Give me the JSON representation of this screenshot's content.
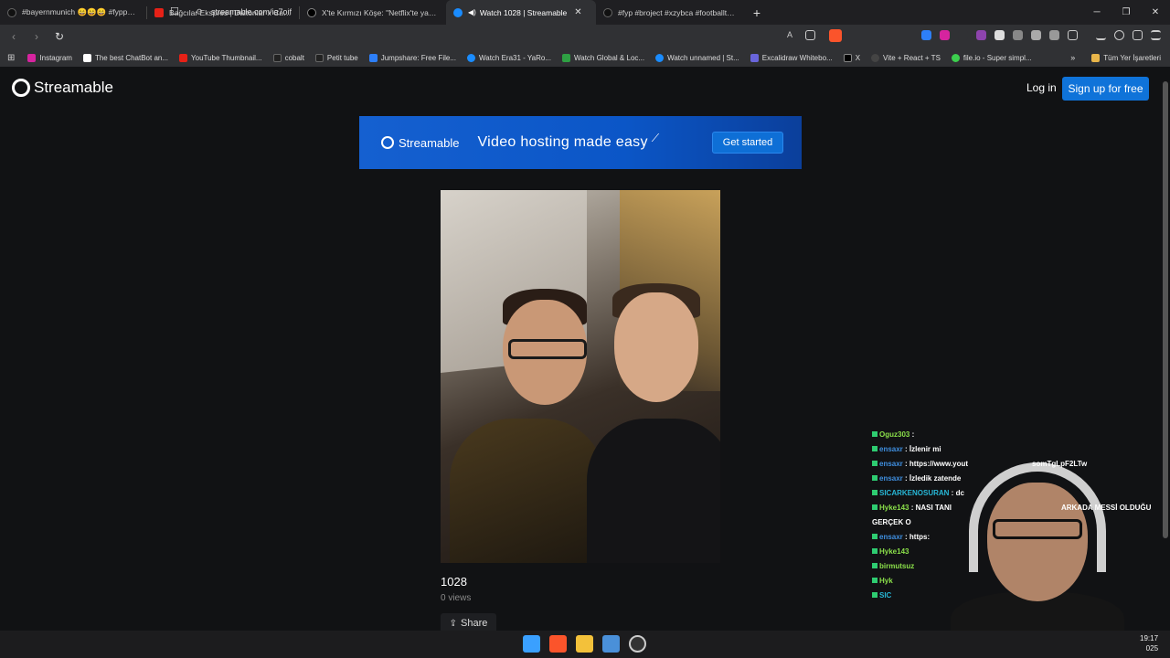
{
  "tabs": [
    {
      "label": "#bayernmunich 😄😄😄 #fypppppp",
      "color": "#111111"
    },
    {
      "label": "Bağcılar Ekspres | Daltonlar x Casper",
      "color": "#e62117"
    },
    {
      "label": "X'te Kırmızı Köşe: \"Netflix'te yayın",
      "color": "#000000"
    },
    {
      "label": "Watch 1028 | Streamable",
      "color": "#1a8cff"
    },
    {
      "label": "#fyp #broject #xzybca #footballtikto",
      "color": "#111111"
    }
  ],
  "address": {
    "url": "streamable.com/ia7oif"
  },
  "bookmarks": [
    {
      "label": "Instagram",
      "color": "#d6249f"
    },
    {
      "label": "The best ChatBot an...",
      "color": "#ffffff"
    },
    {
      "label": "YouTube Thumbnail...",
      "color": "#e62117"
    },
    {
      "label": "cobalt",
      "color": "#222222"
    },
    {
      "label": "Petit tube",
      "color": "#222222"
    },
    {
      "label": "Jumpshare: Free File...",
      "color": "#2d7ff9"
    },
    {
      "label": "Watch Era31 - YaRo...",
      "color": "#1a8cff"
    },
    {
      "label": "Watch Global & Loc...",
      "color": "#2ea043"
    },
    {
      "label": "Watch unnamed | St...",
      "color": "#1a8cff"
    },
    {
      "label": "Excalidraw Whitebo...",
      "color": "#6965db"
    },
    {
      "label": "X",
      "color": "#000000"
    },
    {
      "label": "Vite + React + TS",
      "color": "#444444"
    },
    {
      "label": "file.io - Super simpl...",
      "color": "#3ccf4e"
    }
  ],
  "all_bookmarks_label": "Tüm Yer İşaretleri",
  "site": {
    "logo": "Streamable",
    "login": "Log in",
    "signup": "Sign up for free"
  },
  "banner": {
    "logo": "Streamable",
    "tagline": "Video hosting made easy",
    "cta": "Get started"
  },
  "video": {
    "title": "1028",
    "views": "0 views",
    "share": "Share"
  },
  "chat": [
    {
      "name": "Oguz303",
      "message": "",
      "color": "green"
    },
    {
      "name": "ensaxr",
      "message": "İzlenir mi",
      "color": "blue"
    },
    {
      "name": "ensaxr",
      "message": "https://www.yout",
      "tail": "somTgLpF2LTw",
      "color": "blue"
    },
    {
      "name": "ensaxr",
      "message": "İzledik zatende",
      "color": "blue"
    },
    {
      "name": "SICARKENOSURAN",
      "message": "dc",
      "color": "cyan"
    },
    {
      "name": "Hyke143",
      "message": "NASI TANI",
      "tail": "ARKADA MESSİ OLDUĞU",
      "color": "green"
    },
    {
      "name": "",
      "message": "GERÇEK O",
      "color": "green"
    },
    {
      "name": "ensaxr",
      "message": "https:",
      "color": "blue"
    },
    {
      "name": "Hyke143",
      "message": "",
      "color": "green"
    },
    {
      "name": "birmutsuz",
      "message": "",
      "color": "green"
    },
    {
      "name": "Hyk",
      "message": "",
      "color": "green"
    },
    {
      "name": "SIC",
      "message": "",
      "color": "cyan"
    }
  ],
  "clock": {
    "time": "19:17",
    "date": "025"
  }
}
